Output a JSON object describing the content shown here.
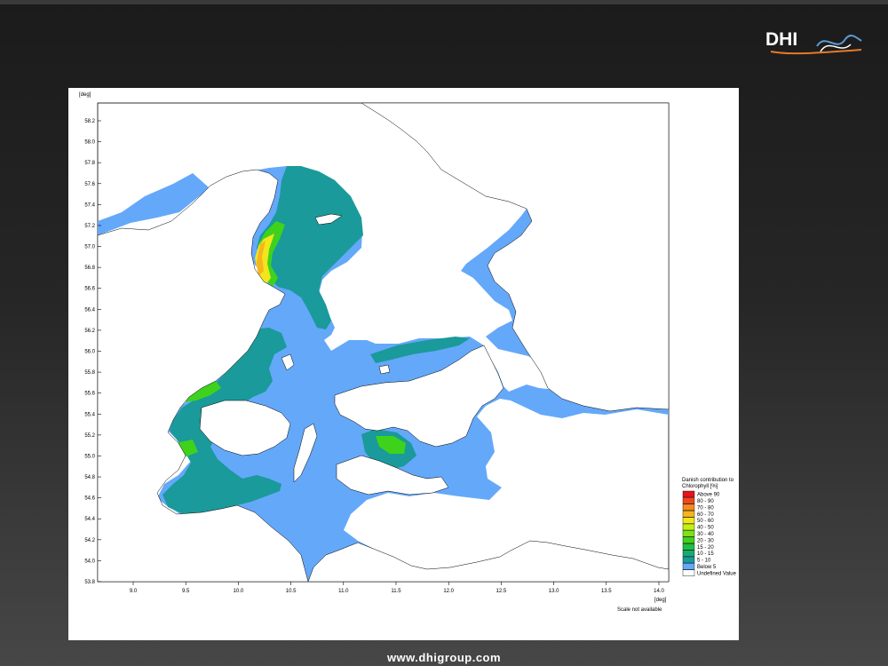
{
  "brand": {
    "logo_text": "DHI",
    "footer_url": "www.dhigroup.com",
    "colors": {
      "orange": "#e8782a",
      "blue": "#5b9ad5",
      "white": "#ffffff"
    }
  },
  "map": {
    "y_unit": "[deg]",
    "x_unit": "[deg]",
    "scale_note": "Scale not available",
    "x_ticks": [
      "9.0",
      "9.5",
      "10.0",
      "10.5",
      "11.0",
      "11.5",
      "12.0",
      "12.5",
      "13.0",
      "13.5",
      "14.0"
    ],
    "y_ticks": [
      "58.2",
      "58.0",
      "57.8",
      "57.6",
      "57.4",
      "57.2",
      "57.0",
      "56.8",
      "56.6",
      "56.4",
      "56.2",
      "56.0",
      "55.8",
      "55.6",
      "55.4",
      "55.2",
      "55.0",
      "54.8",
      "54.6",
      "54.4",
      "54.2",
      "54.0",
      "53.8"
    ],
    "colors": {
      "water": "#64a8fa",
      "land": "#ffffff"
    }
  },
  "legend": {
    "title_line1": "Danish contribution to",
    "title_line2": "Chlorophyll [%]",
    "items": [
      {
        "label": "Above 90",
        "color": "#e4141b"
      },
      {
        "label": "80 - 90",
        "color": "#f2461e"
      },
      {
        "label": "70 - 80",
        "color": "#f58a1f"
      },
      {
        "label": "60 - 70",
        "color": "#f7b41f"
      },
      {
        "label": "50 - 60",
        "color": "#f0e61b"
      },
      {
        "label": "40 - 50",
        "color": "#c4ef17"
      },
      {
        "label": "30 - 40",
        "color": "#7fe214"
      },
      {
        "label": "20 - 30",
        "color": "#3ed21d"
      },
      {
        "label": "15 - 20",
        "color": "#1fbe44"
      },
      {
        "label": "10 - 15",
        "color": "#17ab72"
      },
      {
        "label": "5 - 10",
        "color": "#1a9a9a"
      },
      {
        "label": "Below   5",
        "color": "#64a8fa"
      },
      {
        "label": "Undefined Value",
        "color": "#ffffff"
      }
    ]
  }
}
